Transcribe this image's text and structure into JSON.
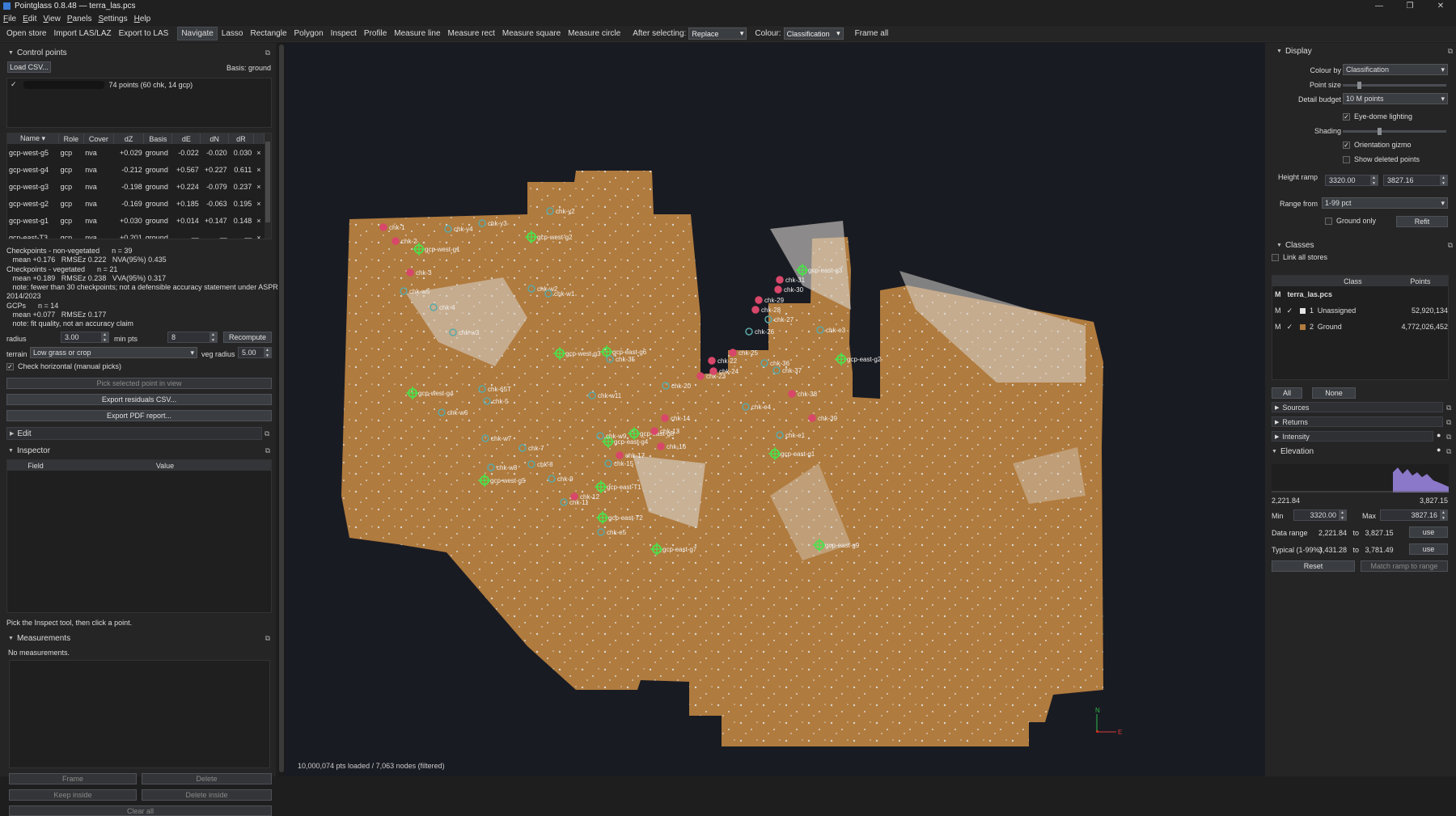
{
  "window": {
    "title": "Pointglass 0.8.48 — terra_las.pcs",
    "min": "—",
    "max": "❐",
    "close": "✕"
  },
  "menu": [
    "File",
    "Edit",
    "View",
    "Panels",
    "Settings",
    "Help"
  ],
  "toolbar": {
    "buttons": [
      "Open store",
      "Import LAS/LAZ",
      "Export to LAS",
      "Navigate",
      "Lasso",
      "Rectangle",
      "Polygon",
      "Inspect",
      "Profile",
      "Measure line",
      "Measure rect",
      "Measure square",
      "Measure circle"
    ],
    "active": "Navigate",
    "after_label": "After selecting:",
    "after_value": "Replace",
    "colour_label": "Colour:",
    "colour_value": "Classification",
    "frame_all": "Frame all"
  },
  "control_points": {
    "title": "Control points",
    "load_btn": "Load CSV...",
    "basis": "Basis: ground",
    "file_entry": "74 points (60 chk, 14 gcp)",
    "columns": [
      "Name",
      "Role",
      "Cover",
      "dZ",
      "Basis",
      "dE",
      "dN",
      "dR",
      ""
    ],
    "rows": [
      [
        "gcp-west-g5",
        "gcp",
        "nva",
        "+0.029",
        "ground",
        "-0.022",
        "-0.020",
        "0.030",
        "×"
      ],
      [
        "gcp-west-g4",
        "gcp",
        "nva",
        "-0.212",
        "ground",
        "+0.567",
        "+0.227",
        "0.611",
        "×"
      ],
      [
        "gcp-west-g3",
        "gcp",
        "nva",
        "-0.198",
        "ground",
        "+0.224",
        "-0.079",
        "0.237",
        "×"
      ],
      [
        "gcp-west-g2",
        "gcp",
        "nva",
        "-0.169",
        "ground",
        "+0.185",
        "-0.063",
        "0.195",
        "×"
      ],
      [
        "gcp-west-g1",
        "gcp",
        "nva",
        "+0.030",
        "ground",
        "+0.014",
        "+0.147",
        "0.148",
        "×"
      ],
      [
        "gcp-east-T3",
        "gcp",
        "nva",
        "+0.201",
        "ground",
        "—",
        "—",
        "—",
        "×"
      ]
    ],
    "stats": [
      "Checkpoints - non-vegetated      n = 39",
      "   mean +0.176   RMSEz 0.222   NVA(95%) 0.435",
      "Checkpoints - vegetated      n = 21",
      "   mean +0.189   RMSEz 0.238   VVA(95%) 0.317",
      "   note: fewer than 30 checkpoints; not a defensible accuracy statement under ASPRS",
      "2014/2023",
      "GCPs      n = 14",
      "   mean +0.077   RMSEz 0.177",
      "   note: fit quality, not an accuracy claim"
    ],
    "radius_label": "radius",
    "radius_value": "3.00",
    "minpts_label": "min pts",
    "minpts_value": "8",
    "recompute": "Recompute",
    "terrain_label": "terrain",
    "terrain_value": "Low grass or crop",
    "vegradius_label": "veg radius",
    "vegradius_value": "5.00",
    "check_horizontal": "Check horizontal (manual picks)",
    "pick_btn": "Pick selected point in view",
    "export_csv": "Export residuals CSV...",
    "export_pdf": "Export PDF report..."
  },
  "edit": {
    "title": "Edit"
  },
  "inspector": {
    "title": "Inspector",
    "col_field": "Field",
    "col_value": "Value",
    "hint": "Pick the Inspect tool, then click a point."
  },
  "measurements": {
    "title": "Measurements",
    "empty": "No measurements.",
    "frame": "Frame",
    "delete": "Delete",
    "keep_inside": "Keep inside",
    "delete_inside": "Delete inside",
    "clear_all": "Clear all"
  },
  "viewport": {
    "status": "10,000,074 pts loaded   /   7,063 nodes  (filtered)",
    "axis_n": "N",
    "axis_e": "E",
    "markers": [
      {
        "label": "chk-y3",
        "type": "chk"
      },
      {
        "label": "chk-y2",
        "type": "chk"
      },
      {
        "label": "chk-1",
        "type": "red"
      },
      {
        "label": "chk-3",
        "type": "red"
      },
      {
        "label": "chk-2",
        "type": "red"
      },
      {
        "label": "chk-y4",
        "type": "chk"
      },
      {
        "label": "gcp-west-g1",
        "type": "gcp"
      },
      {
        "label": "gcp-west-g2",
        "type": "gcp"
      },
      {
        "label": "chk-w5",
        "type": "chk"
      },
      {
        "label": "chk-w2",
        "type": "chk"
      },
      {
        "label": "chk-w1",
        "type": "chk"
      },
      {
        "label": "chk-4",
        "type": "chk"
      },
      {
        "label": "chk-w3",
        "type": "chk"
      },
      {
        "label": "gcp-west-g3",
        "type": "gcp"
      },
      {
        "label": "gcp-east-g6",
        "type": "gcp"
      },
      {
        "label": "gcp-west-g4",
        "type": "gcp"
      },
      {
        "label": "chk-65T",
        "type": "chk"
      },
      {
        "label": "chk-5",
        "type": "chk"
      },
      {
        "label": "chk-w6",
        "type": "chk"
      },
      {
        "label": "chk-w11",
        "type": "chk"
      },
      {
        "label": "chk-w7",
        "type": "chk"
      },
      {
        "label": "chk-7",
        "type": "chk"
      },
      {
        "label": "chk-w8",
        "type": "chk"
      },
      {
        "label": "chk-8",
        "type": "chk"
      },
      {
        "label": "gcp-west-g5",
        "type": "gcp"
      },
      {
        "label": "chk-9",
        "type": "chk"
      },
      {
        "label": "gcp-east-T1",
        "type": "gcp"
      },
      {
        "label": "chk-11",
        "type": "chk"
      },
      {
        "label": "chk-12",
        "type": "red"
      },
      {
        "label": "gcp-east-T2",
        "type": "gcp"
      },
      {
        "label": "chk-e5",
        "type": "chk"
      },
      {
        "label": "gcp-east-g7",
        "type": "gcp"
      },
      {
        "label": "gcp-east-g8",
        "type": "gcp"
      },
      {
        "label": "chk-17",
        "type": "red"
      },
      {
        "label": "chk-15",
        "type": "chk"
      },
      {
        "label": "gcp-east-g4",
        "type": "gcp"
      },
      {
        "label": "chk-w9",
        "type": "chk"
      },
      {
        "label": "chk-14",
        "type": "red"
      },
      {
        "label": "chk-13",
        "type": "red"
      },
      {
        "label": "chk-16",
        "type": "red"
      },
      {
        "label": "chk-20",
        "type": "chk"
      },
      {
        "label": "chk-22",
        "type": "red"
      },
      {
        "label": "chk-23",
        "type": "red"
      },
      {
        "label": "chk-24",
        "type": "red"
      },
      {
        "label": "chk-25",
        "type": "red"
      },
      {
        "label": "chk-26",
        "type": "chk"
      },
      {
        "label": "chk-27",
        "type": "chk"
      },
      {
        "label": "chk-28",
        "type": "red"
      },
      {
        "label": "chk-29",
        "type": "red"
      },
      {
        "label": "chk-30",
        "type": "red"
      },
      {
        "label": "chk-31",
        "type": "red"
      },
      {
        "label": "gcp-east-g3",
        "type": "gcp"
      },
      {
        "label": "chk-36",
        "type": "chk"
      },
      {
        "label": "chk-37",
        "type": "chk"
      },
      {
        "label": "chk-38",
        "type": "red"
      },
      {
        "label": "chk-e3",
        "type": "chk"
      },
      {
        "label": "gcp-east-g2",
        "type": "gcp"
      },
      {
        "label": "chk-e4",
        "type": "chk"
      },
      {
        "label": "chk-39",
        "type": "red"
      },
      {
        "label": "chk-e1",
        "type": "chk"
      },
      {
        "label": "gcp-east-g1",
        "type": "gcp"
      },
      {
        "label": "gcp-east-g9",
        "type": "gcp"
      },
      {
        "label": "chk-35",
        "type": "chk"
      }
    ]
  },
  "display": {
    "title": "Display",
    "colour_by_label": "Colour by",
    "colour_by_value": "Classification",
    "point_size_label": "Point size",
    "point_size_level": 0.15,
    "detail_label": "Detail budget",
    "detail_value": "10 M points",
    "edl": "Eye-dome lighting",
    "shading_label": "Shading",
    "shading_level": 0.35,
    "gizmo": "Orientation gizmo",
    "show_deleted": "Show deleted points",
    "height_ramp_label": "Height ramp",
    "height_min": "3320.00",
    "height_max": "3827.16",
    "range_from_label": "Range from",
    "range_from_value": "1-99 pct",
    "ground_only": "Ground only",
    "refit": "Refit"
  },
  "classes": {
    "title": "Classes",
    "link_all": "Link all stores",
    "col_class": "Class",
    "col_points": "Points",
    "store": "terra_las.pcs",
    "store_m": "M",
    "rows": [
      {
        "m": "M",
        "id": "1",
        "name": "Unassigned",
        "points": "52,920,134",
        "color": "#e6e6e6"
      },
      {
        "m": "M",
        "id": "2",
        "name": "Ground",
        "points": "4,772,026,452",
        "color": "#b07b3e"
      }
    ],
    "all": "All",
    "none": "None"
  },
  "sections": [
    "Sources",
    "Returns",
    "Intensity"
  ],
  "elevation": {
    "title": "Elevation",
    "hist_min": "2,221.84",
    "hist_max": "3,827.15",
    "min_label": "Min",
    "min_value": "3320.00",
    "max_label": "Max",
    "max_value": "3827.16",
    "data_range_label": "Data range",
    "data_range_value": "2,221.84   to   3,827.15",
    "typical_label": "Typical (1-99%)",
    "typical_value": "3,431.28   to   3,781.49",
    "use": "use",
    "reset": "Reset",
    "match": "Match ramp to range"
  }
}
